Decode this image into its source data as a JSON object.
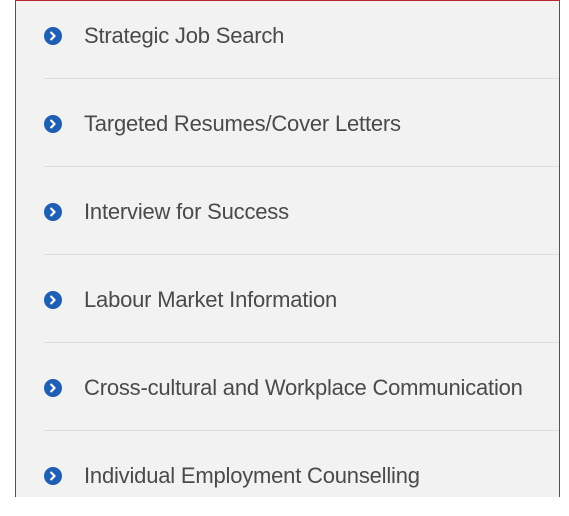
{
  "menu": {
    "items": [
      {
        "label": "Strategic Job Search",
        "icon": "chevron-right-circle-icon"
      },
      {
        "label": "Targeted Resumes/Cover Letters",
        "icon": "chevron-right-circle-icon"
      },
      {
        "label": "Interview for Success",
        "icon": "chevron-right-circle-icon"
      },
      {
        "label": "Labour Market Information",
        "icon": "chevron-right-circle-icon"
      },
      {
        "label": "Cross-cultural and Workplace Communication",
        "icon": "chevron-right-circle-icon"
      },
      {
        "label": "Individual Employment Counselling",
        "icon": "chevron-right-circle-icon"
      }
    ]
  },
  "colors": {
    "icon": "#1e5fb3",
    "text": "#4a4a4a",
    "panel_bg": "#f2f2f2",
    "border": "#b8262f",
    "divider": "#dddddd"
  }
}
